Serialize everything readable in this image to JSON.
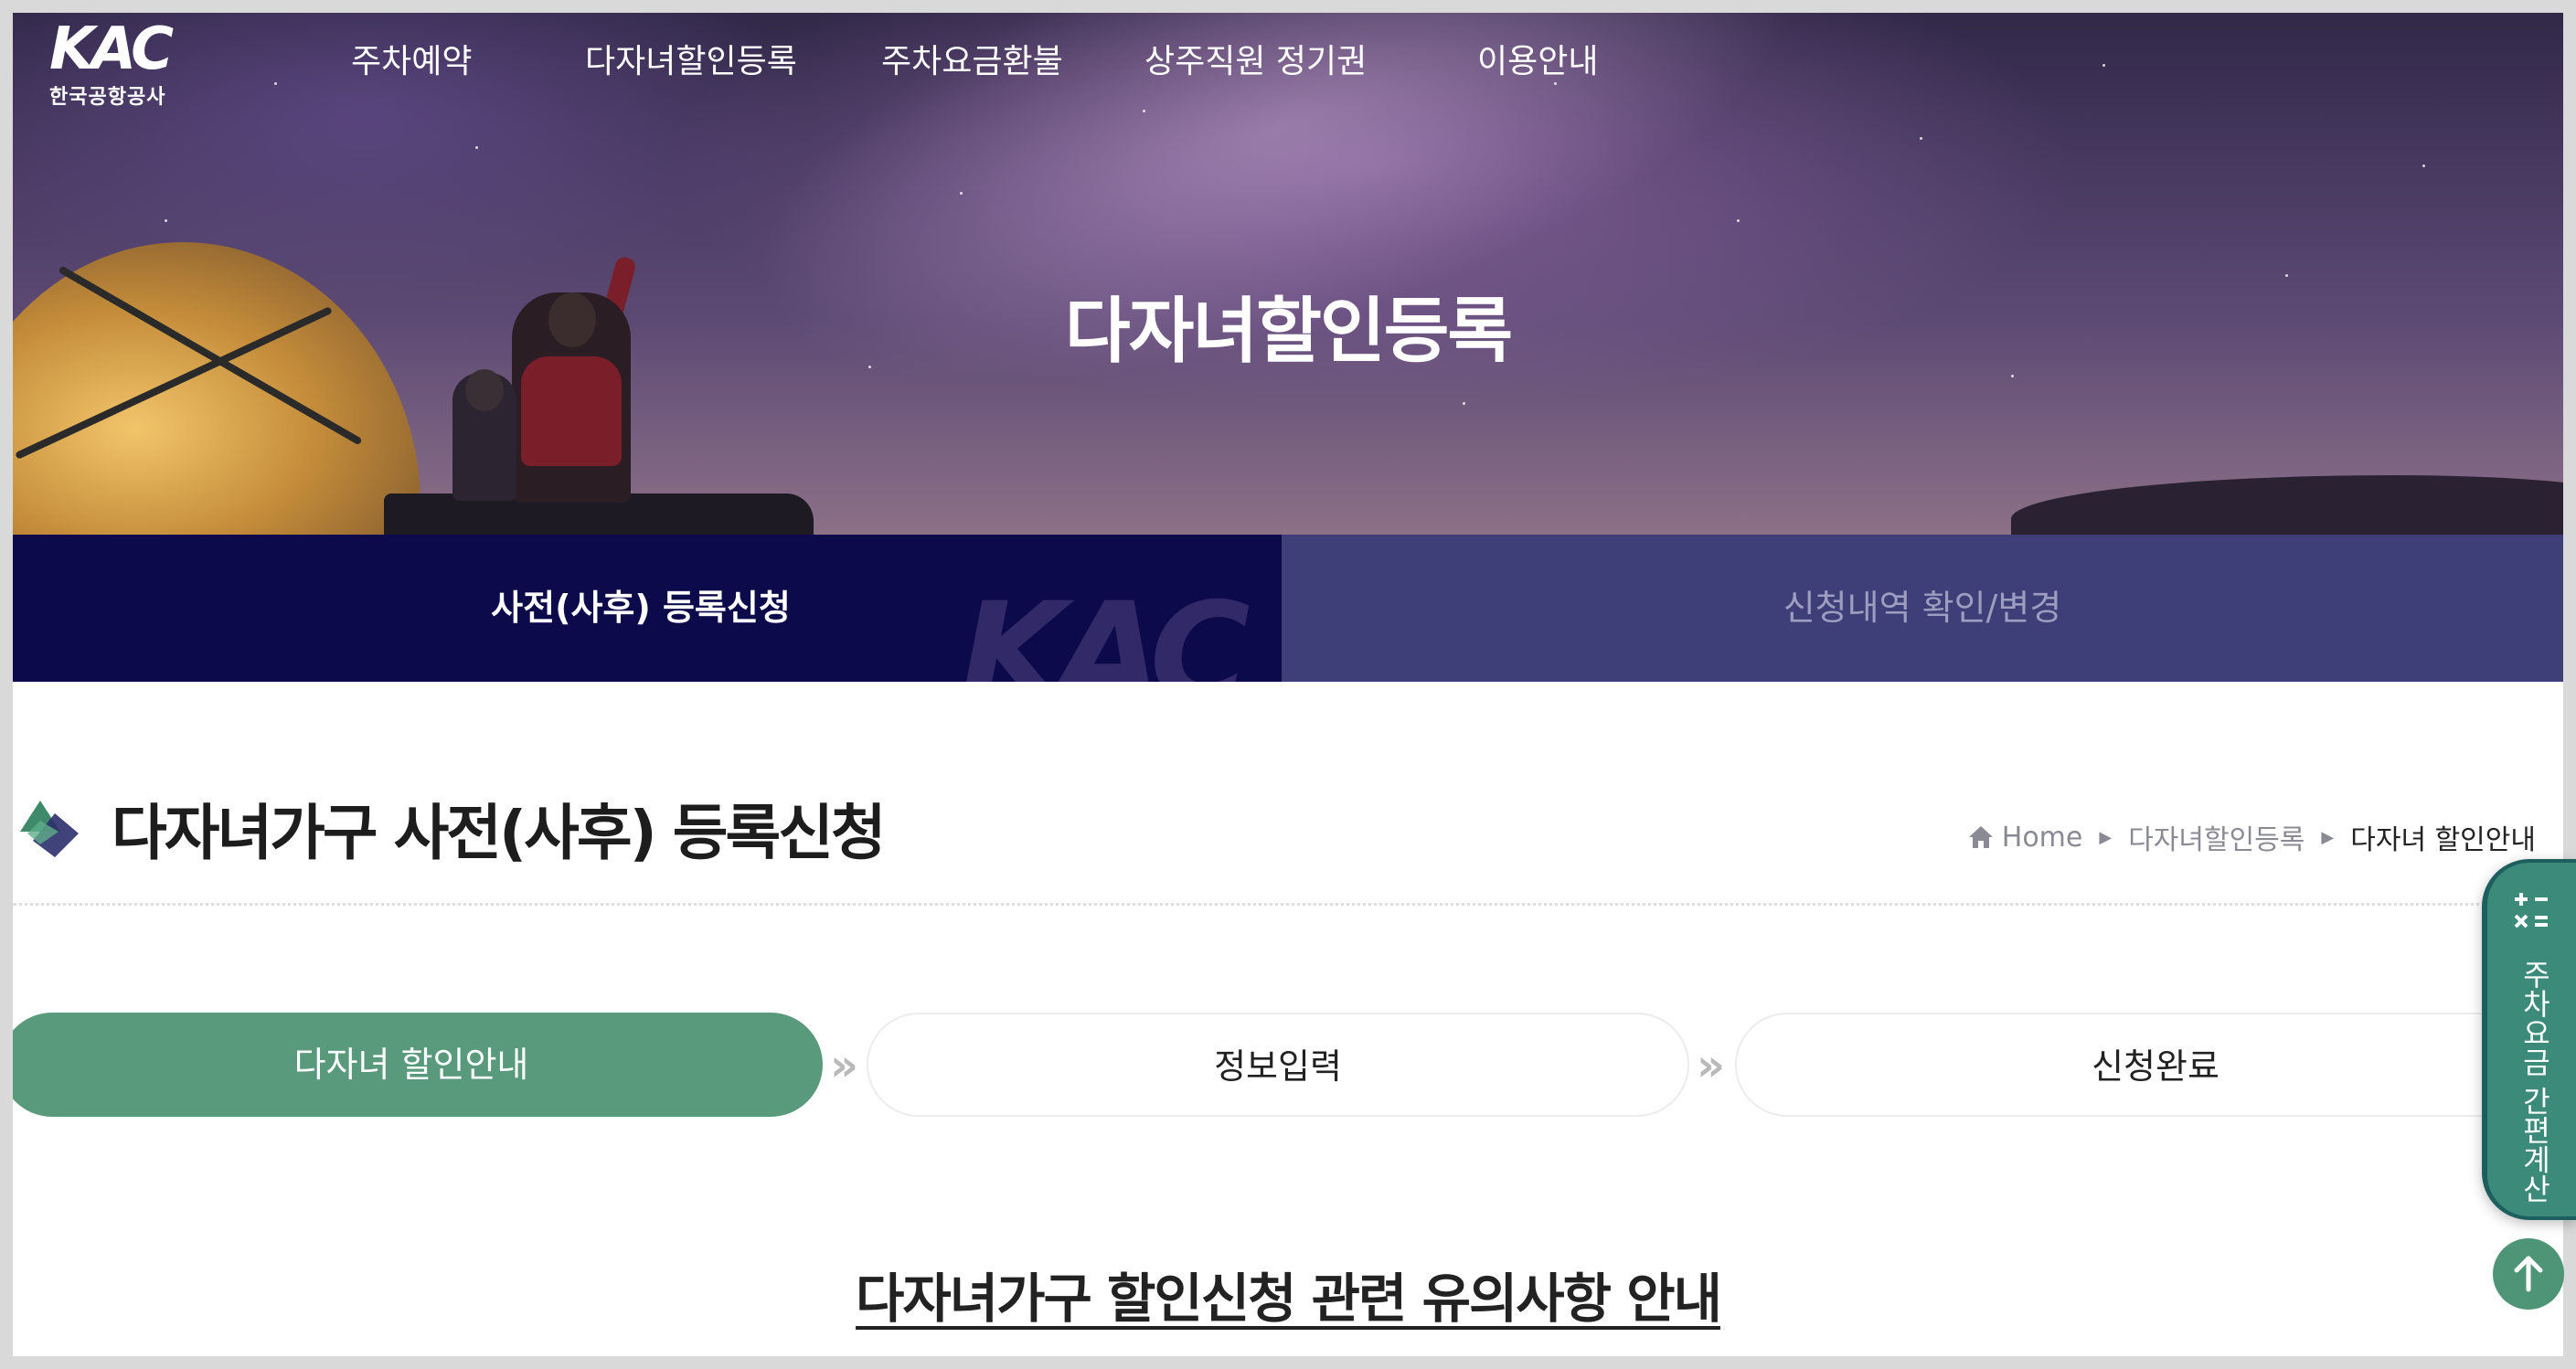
{
  "brand": {
    "logo_mark": "KAC",
    "logo_text": "한국공항공사"
  },
  "nav": {
    "items": [
      {
        "label": "주차예약"
      },
      {
        "label": "다자녀할인등록"
      },
      {
        "label": "주차요금환불"
      },
      {
        "label": "상주직원 정기권"
      },
      {
        "label": "이용안내"
      }
    ]
  },
  "hero": {
    "title": "다자녀할인등록"
  },
  "tabs": {
    "items": [
      {
        "label": "사전(사후) 등록신청",
        "active": true
      },
      {
        "label": "신청내역 확인/변경",
        "active": false
      }
    ],
    "watermark": "KAC"
  },
  "page": {
    "title": "다자녀가구 사전(사후) 등록신청"
  },
  "breadcrumb": {
    "home": "Home",
    "items": [
      "다자녀할인등록",
      "다자녀 할인안내"
    ]
  },
  "steps": {
    "items": [
      {
        "label": "다자녀 할인안내",
        "active": true
      },
      {
        "label": "정보입력",
        "active": false
      },
      {
        "label": "신청완료",
        "active": false
      }
    ]
  },
  "notice": {
    "heading": "다자녀가구 할인신청 관련 유의사항 안내"
  },
  "floating": {
    "calculator_label": "주차요금 간편계산",
    "top_button_icon": "arrow-up-icon",
    "calculator_icon": "calculator-icon"
  },
  "colors": {
    "tab_active_bg": "#0c0a4a",
    "tab_inactive_bg": "#3e3f78",
    "step_active_bg": "#5a9a7c",
    "calculator_bg": "#3c8a7a",
    "top_button_bg": "#4d9576"
  }
}
